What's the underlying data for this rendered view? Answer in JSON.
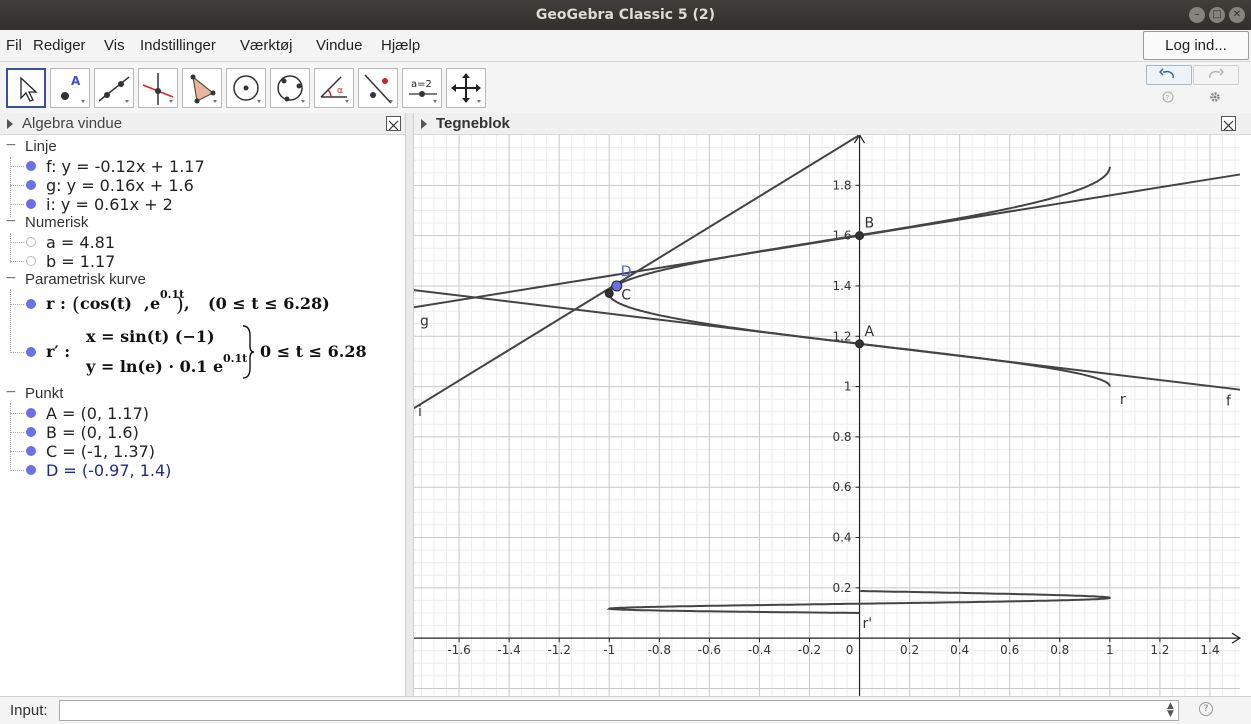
{
  "window": {
    "title": "GeoGebra Classic 5 (2)"
  },
  "menu": [
    "Fil",
    "Rediger",
    "Vis",
    "Indstillinger",
    "Værktøj",
    "Vindue",
    "Hjælp"
  ],
  "login_label": "Log ind...",
  "toolbar": {
    "tools": [
      "move-tool",
      "point-tool",
      "line-tool",
      "perpendicular-line-tool",
      "polygon-tool",
      "circle-tool",
      "conic-tool",
      "angle-tool",
      "reflect-tool",
      "slider-tool",
      "move-graphics-tool"
    ],
    "slider_tool_text": "a=2"
  },
  "algebra": {
    "title": "Algebra vindue",
    "categories": {
      "linje": "Linje",
      "numerisk": "Numerisk",
      "parametrisk": "Parametrisk kurve",
      "punkt": "Punkt"
    },
    "lines": [
      "f: y = -0.12x + 1.17",
      "g: y = 0.16x + 1.6",
      "i: y = 0.61x + 2"
    ],
    "numbers": [
      "a = 4.81",
      "b = 1.17"
    ],
    "curve_r": {
      "name": "r :",
      "cos": "cos(t)",
      "exp": "e",
      "exp_sup": "0.1t",
      "range": "(0 ≤ t ≤ 6.28)"
    },
    "curve_rp": {
      "name": "r′ :",
      "x_expr": "x = sin(t) (−1)",
      "y_expr": "y = ln(e) · 0.1 e",
      "y_sup": "0.1t",
      "range": "0 ≤ t ≤ 6.28"
    },
    "points": [
      "A = (0, 1.17)",
      "B = (0, 1.6)",
      "C = (-1, 1.37)",
      "D = (-0.97, 1.4)"
    ]
  },
  "graphics": {
    "title": "Tegneblok",
    "x_ticks": [
      "-1.6",
      "-1.4",
      "-1.2",
      "-1",
      "-0.8",
      "-0.6",
      "-0.4",
      "-0.2",
      "0",
      "0.2",
      "0.4",
      "0.6",
      "0.8",
      "1",
      "1.2",
      "1.4"
    ],
    "y_ticks": [
      "0.2",
      "0.4",
      "0.6",
      "0.8",
      "1",
      "1.2",
      "1.4",
      "1.6",
      "1.8"
    ],
    "xlim": [
      -1.78,
      1.52
    ],
    "ylim": [
      -0.23,
      2.0
    ],
    "lines": [
      {
        "label": "f",
        "m": -0.12,
        "c": 1.17
      },
      {
        "label": "g",
        "m": 0.16,
        "c": 1.6
      },
      {
        "label": "i",
        "m": 0.61,
        "c": 2.0
      }
    ],
    "points": [
      {
        "label": "A",
        "x": 0,
        "y": 1.17
      },
      {
        "label": "B",
        "x": 0,
        "y": 1.6
      },
      {
        "label": "C",
        "x": -1,
        "y": 1.37
      },
      {
        "label": "D",
        "x": -0.97,
        "y": 1.4
      }
    ],
    "curve_labels": {
      "r": "r",
      "r_prime": "r'"
    },
    "colors": {
      "grid_minor": "#ececec",
      "grid_major": "#c8c8c8",
      "axis": "#222222",
      "object": "#444444",
      "point": "#333333",
      "selected_point": "#6b6fe8",
      "selected_label": "#5b5fd8"
    }
  },
  "input": {
    "label": "Input:",
    "value": ""
  }
}
